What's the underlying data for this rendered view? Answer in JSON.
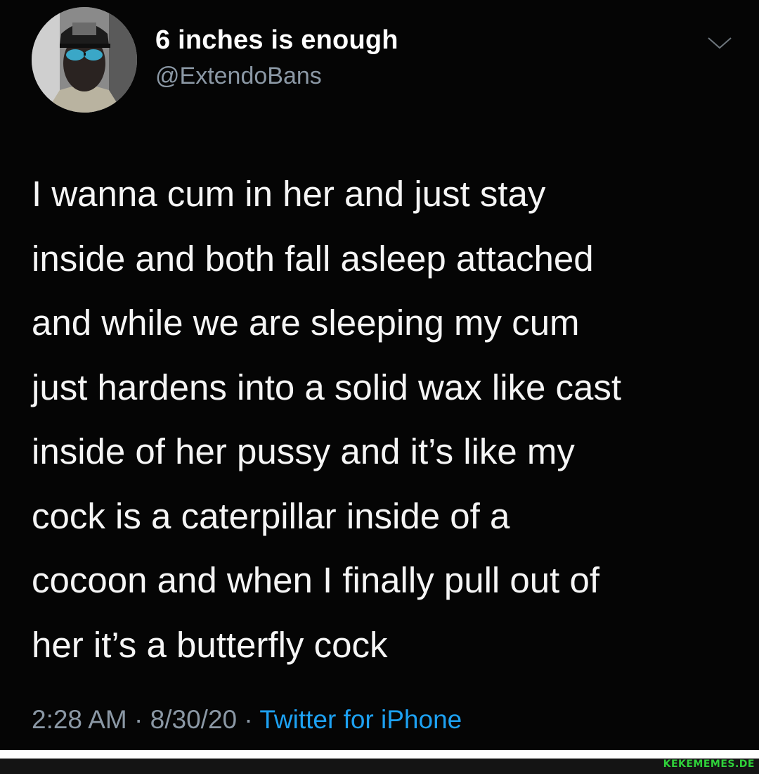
{
  "tweet": {
    "display_name": "6 inches is enough",
    "handle": "@ExtendoBans",
    "text_lines": [
      "I wanna cum in her and just stay",
      "inside and both fall asleep attached",
      "and while we are sleeping my cum",
      "just hardens into a solid wax like cast",
      "inside of her pussy and it’s like my",
      "cock is a caterpillar inside of a",
      "cocoon and when I finally pull out of",
      "her it’s a butterfly cock"
    ],
    "time": "2:28 AM",
    "date": "8/30/20",
    "separator": " · ",
    "source": "Twitter for iPhone"
  },
  "icons": {
    "avatar": "avatar-photo",
    "menu": "chevron-down-icon"
  },
  "colors": {
    "background": "#050505",
    "text": "#f5f5f5",
    "secondary": "#8b98a5",
    "link": "#1da1f2",
    "watermark": "#2fd13a"
  },
  "watermark": "KEKEMEMES.DE"
}
